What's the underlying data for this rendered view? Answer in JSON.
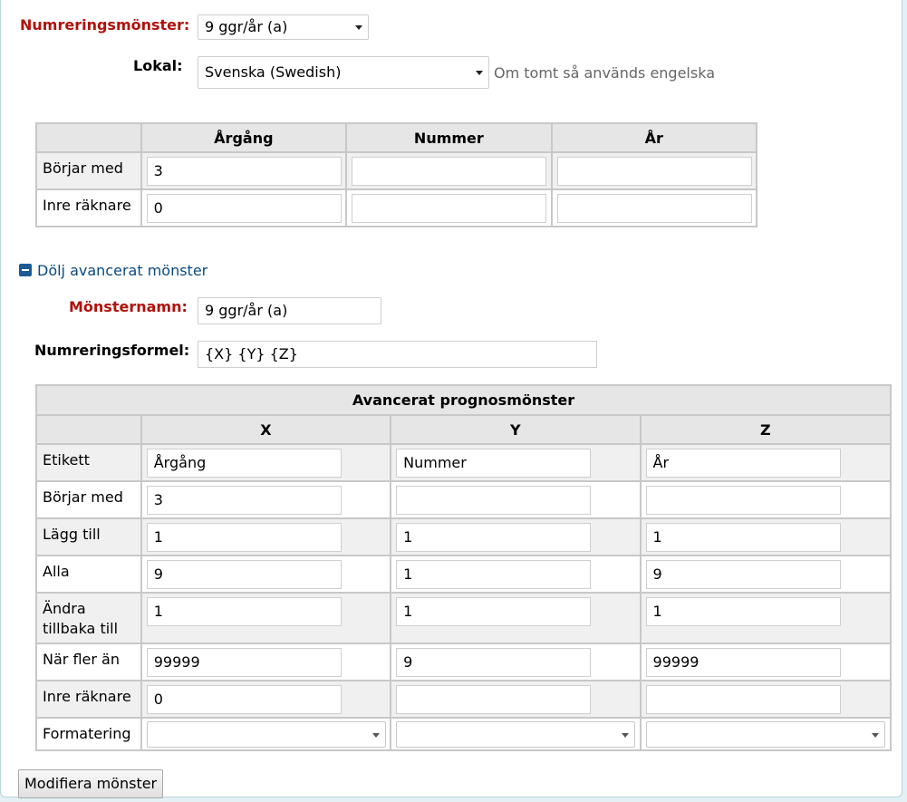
{
  "form": {
    "numbering_pattern_label": "Numreringsmönster:",
    "numbering_pattern_value": "9 ggr/år (a)",
    "locale_label": "Lokal:",
    "locale_value": "Svenska (Swedish)",
    "locale_hint": "Om tomt så används engelska"
  },
  "basic_table": {
    "headers": [
      "Årgång",
      "Nummer",
      "År"
    ],
    "rows": [
      {
        "label": "Börjar med",
        "values": [
          "3",
          "",
          ""
        ]
      },
      {
        "label": "Inre räknare",
        "values": [
          "0",
          "",
          ""
        ]
      }
    ]
  },
  "advanced_toggle": {
    "label": "Dölj avancerat mönster",
    "icon": "minus-icon"
  },
  "advanced": {
    "pattern_name_label": "Mönsternamn:",
    "pattern_name_value": "9 ggr/år (a)",
    "formula_label": "Numreringsformel:",
    "formula_value": "{X} {Y} {Z}"
  },
  "advanced_table": {
    "title": "Avancerat prognosmönster",
    "headers": [
      "X",
      "Y",
      "Z"
    ],
    "rows": [
      {
        "label": "Etikett",
        "values": [
          "Årgång",
          "Nummer",
          "År"
        ]
      },
      {
        "label": "Börjar med",
        "values": [
          "3",
          "",
          ""
        ]
      },
      {
        "label": "Lägg till",
        "values": [
          "1",
          "1",
          "1"
        ]
      },
      {
        "label": "Alla",
        "values": [
          "9",
          "1",
          "9"
        ]
      },
      {
        "label_line1": "Ändra",
        "label_line2": "tillbaka till",
        "values": [
          "1",
          "1",
          "1"
        ]
      },
      {
        "label": "När fler än",
        "values": [
          "99999",
          "9",
          "99999"
        ]
      },
      {
        "label": "Inre räknare",
        "values": [
          "0",
          "",
          ""
        ]
      },
      {
        "label": "Formatering",
        "values": [
          "",
          "",
          ""
        ]
      }
    ]
  },
  "actions": {
    "modify_button": "Modifiera mönster"
  },
  "colors": {
    "required_label": "#b0120c",
    "link": "#0a4a80",
    "page_bg": "#e4f0f4"
  }
}
